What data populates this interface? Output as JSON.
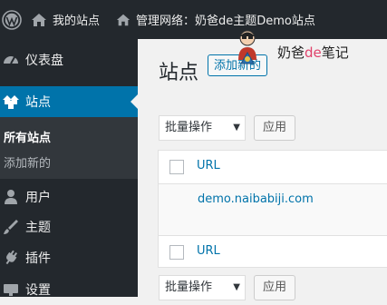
{
  "adminbar": {
    "site_label": "我的站点",
    "network_label": "管理网络：奶爸de主题Demo站点"
  },
  "sidebar": {
    "items": [
      {
        "label": "仪表盘",
        "icon": "dashboard-icon"
      },
      {
        "label": "站点",
        "icon": "sites-icon"
      },
      {
        "label": "用户",
        "icon": "users-icon"
      },
      {
        "label": "主题",
        "icon": "themes-icon"
      },
      {
        "label": "插件",
        "icon": "plugins-icon"
      },
      {
        "label": "设置",
        "icon": "settings-icon"
      }
    ],
    "submenu": {
      "all_sites": "所有站点",
      "add_new": "添加新的"
    }
  },
  "main": {
    "title": "站点",
    "add_new_label": "添加新的",
    "bulk_actions_label": "批量操作",
    "apply_label": "应用",
    "table": {
      "column_url": "URL",
      "rows": [
        {
          "url": "demo.naibabiji.com"
        }
      ]
    }
  },
  "watermark": {
    "text_prefix": "奶爸",
    "text_accent": "de",
    "text_suffix": "笔记"
  },
  "colors": {
    "adminbar_bg": "#23282d",
    "sidebar_bg": "#23282d",
    "active_menu_bg": "#0073aa",
    "link": "#0073aa",
    "page_bg": "#f1f1f1",
    "watermark_accent": "#e0426b"
  }
}
